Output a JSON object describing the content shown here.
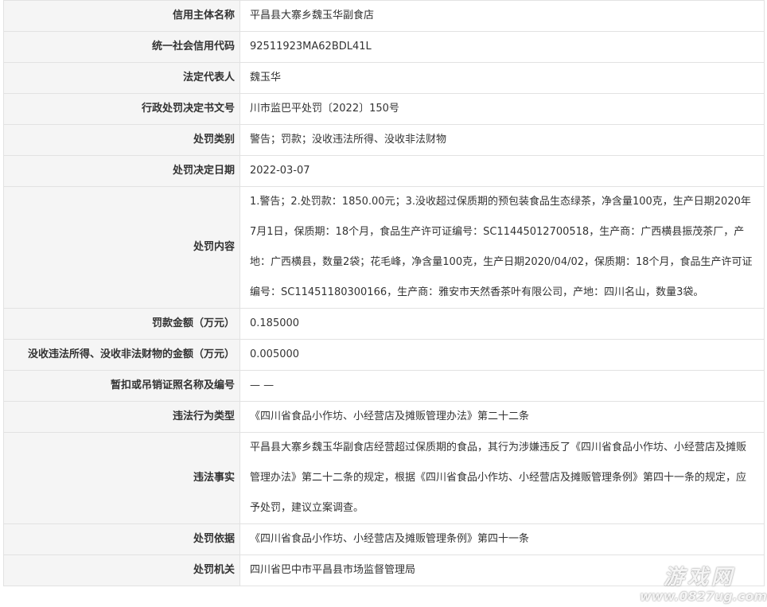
{
  "rows": [
    {
      "label": "信用主体名称",
      "value": "平昌县大寨乡魏玉华副食店"
    },
    {
      "label": "统一社会信用代码",
      "value": "92511923MA62BDL41L"
    },
    {
      "label": "法定代表人",
      "value": "魏玉华"
    },
    {
      "label": "行政处罚决定书文号",
      "value": "川市监巴平处罚〔2022〕150号"
    },
    {
      "label": "处罚类别",
      "value": "警告；罚款；没收违法所得、没收非法财物"
    },
    {
      "label": "处罚决定日期",
      "value": "2022-03-07"
    },
    {
      "label": "处罚内容",
      "value": "1.警告；2.处罚款：1850.00元；3.没收超过保质期的预包装食品生态绿茶，净含量100克，生产日期2020年7月1日，保质期：18个月，食品生产许可证编号：SC11445012700518，生产商：广西横县振茂茶厂，产地：广西横县，数量2袋；花毛峰，净含量100克，生产日期2020/04/02，保质期：18个月，食品生产许可证编号：SC11451180300166，生产商：雅安市天然香茶叶有限公司，产地：四川名山，数量3袋。"
    },
    {
      "label": "罚款金额（万元）",
      "value": "0.185000"
    },
    {
      "label": "没收违法所得、没收非法财物的金额（万元）",
      "value": "0.005000"
    },
    {
      "label": "暂扣或吊销证照名称及编号",
      "value": "— —"
    },
    {
      "label": "违法行为类型",
      "value": "《四川省食品小作坊、小经营店及摊贩管理办法》第二十二条"
    },
    {
      "label": "违法事实",
      "value": "平昌县大寨乡魏玉华副食店经营超过保质期的食品，其行为涉嫌违反了《四川省食品小作坊、小经营店及摊贩管理办法》第二十二条的规定，根据《四川省食品小作坊、小经营店及摊贩管理条例》第四十一条的规定，应予处罚，建议立案调查。"
    },
    {
      "label": "处罚依据",
      "value": "《四川省食品小作坊、小经营店及摊贩管理条例》第四十一条"
    },
    {
      "label": "处罚机关",
      "value": "四川省巴中市平昌县市场监督管理局"
    }
  ],
  "watermark": {
    "title": "游戏网",
    "url": "www.0827ug.com"
  }
}
